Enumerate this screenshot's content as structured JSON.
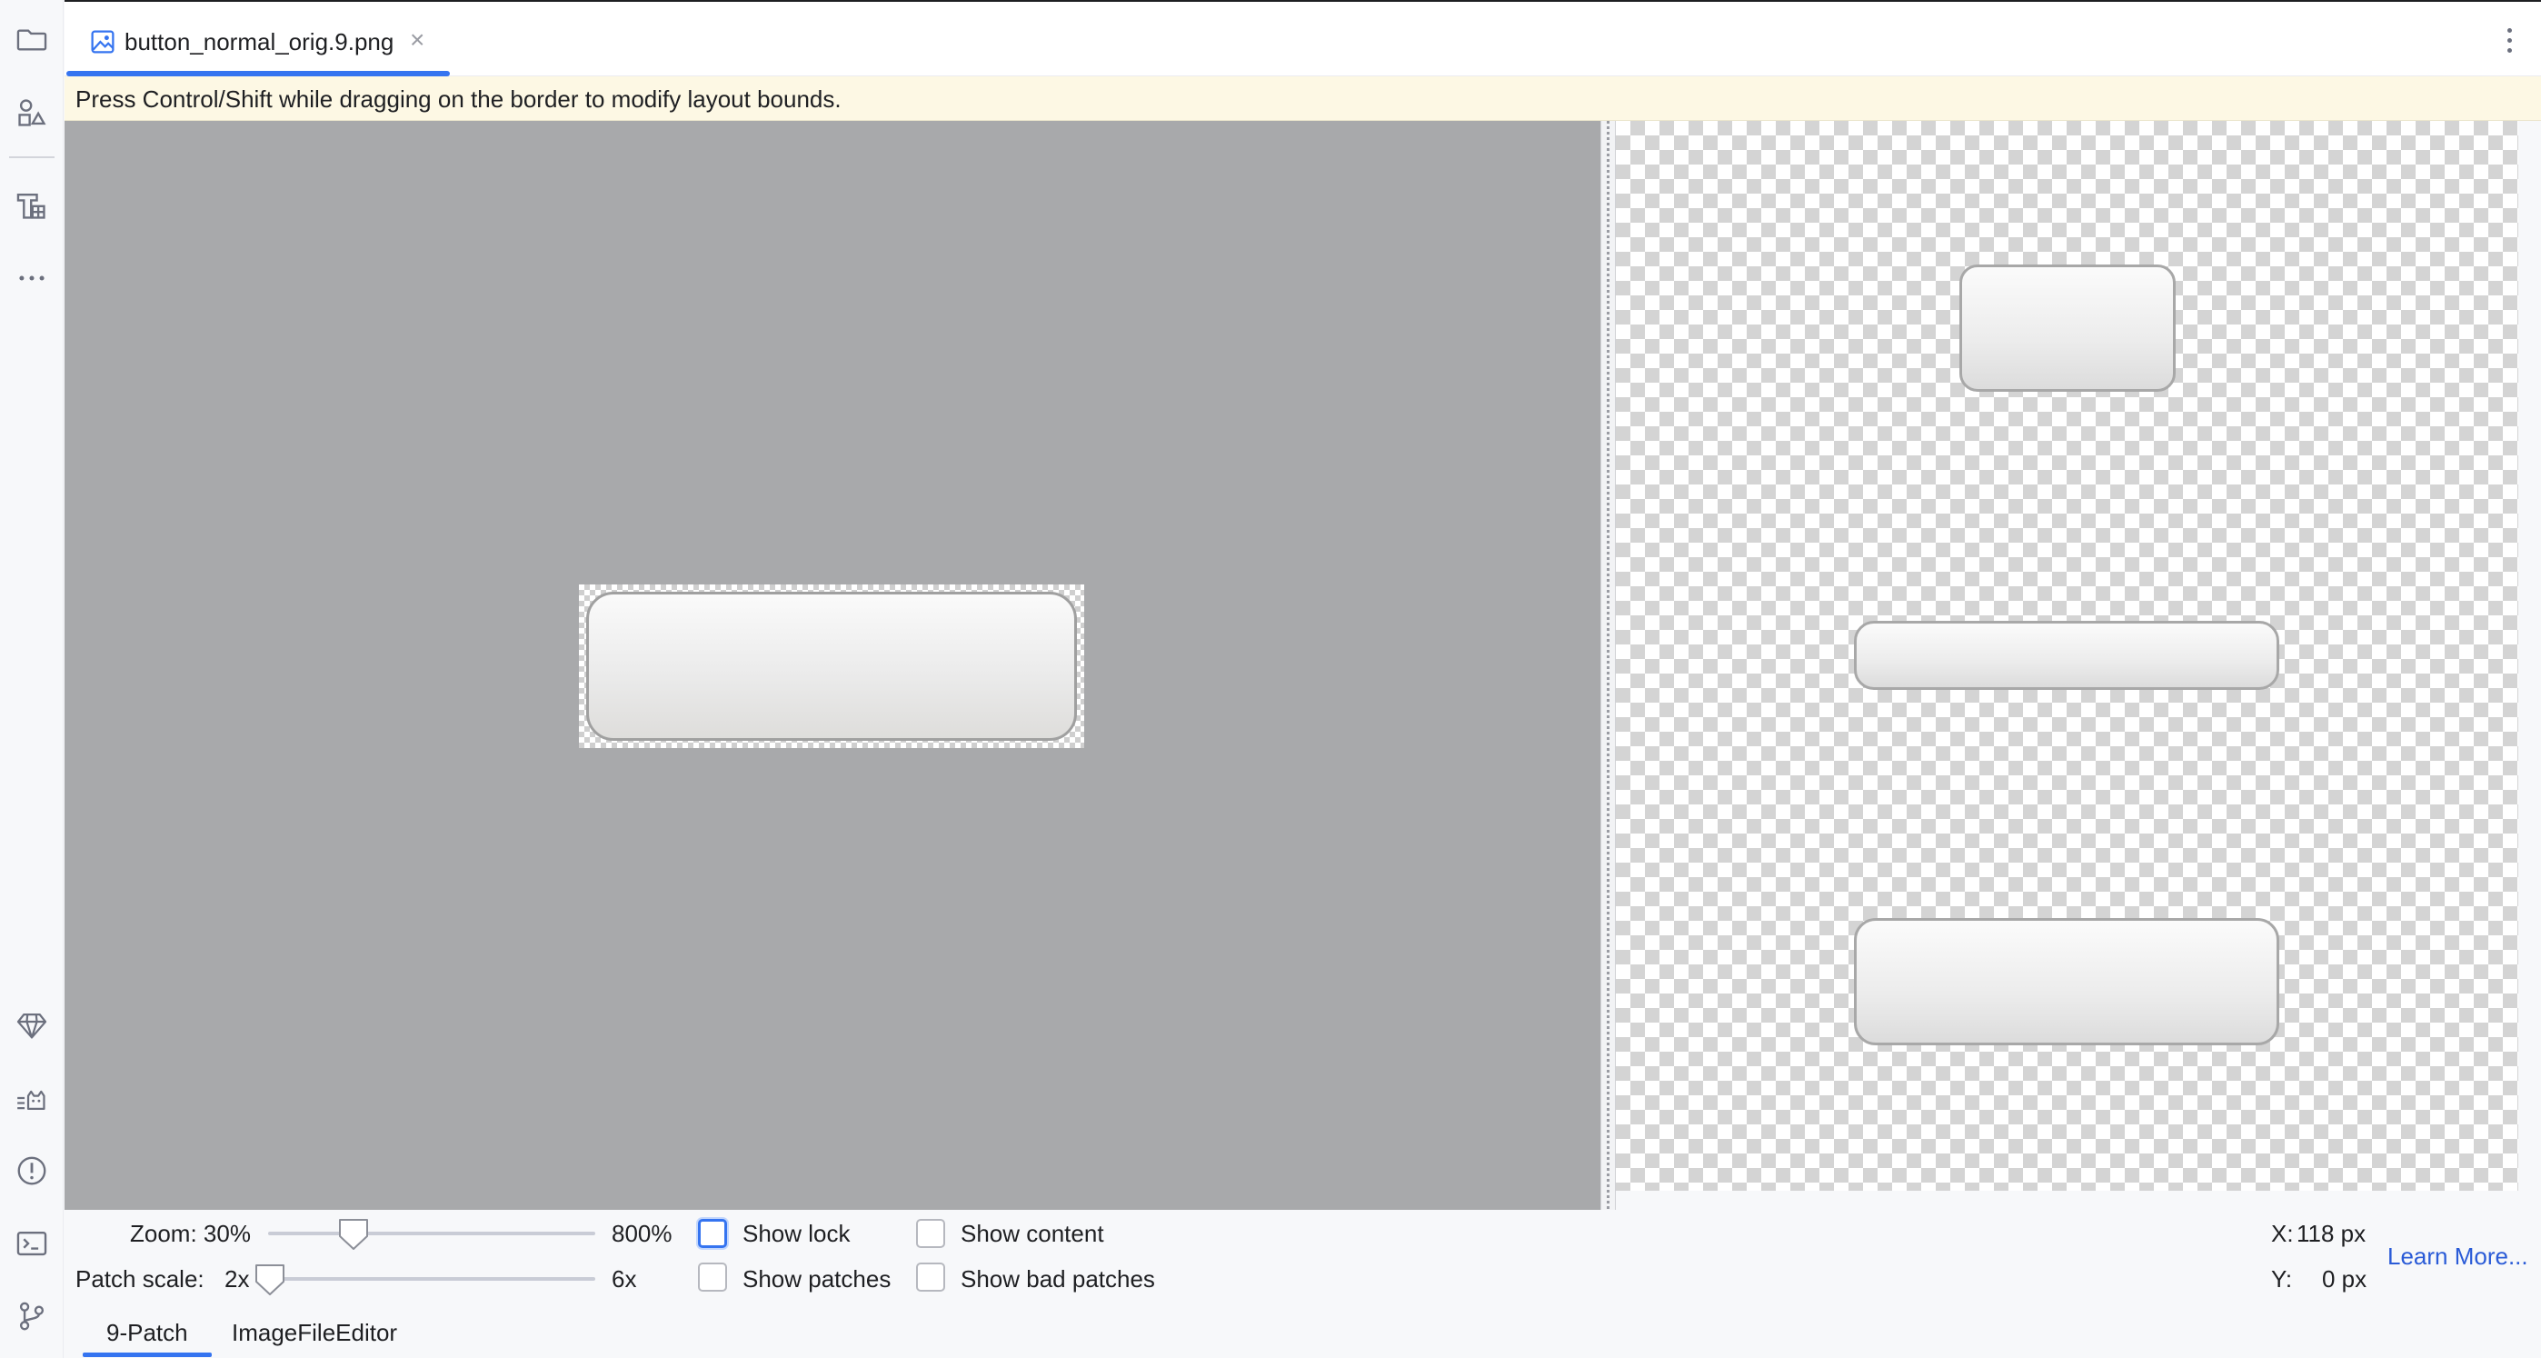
{
  "tool_window_bar": {
    "top_icons": [
      "folder-icon",
      "shapes-icon",
      "resource-manager-icon",
      "more-icon"
    ],
    "bottom_icons": [
      "gem-icon",
      "cat-icon",
      "problems-icon",
      "terminal-icon",
      "git-branch-icon"
    ]
  },
  "editor_tabs": [
    {
      "title": "button_normal_orig.9.png",
      "icon": "image-file-icon",
      "active": true,
      "close_glyph": "×"
    }
  ],
  "banner": {
    "text": "Press Control/Shift while dragging on the border to modify layout bounds."
  },
  "controls": {
    "zoom_label": "Zoom: 30%",
    "zoom_max_label": "800%",
    "zoom_value_percent": 30,
    "patch_scale_label": "Patch scale:",
    "patch_scale_min_label": "2x",
    "patch_scale_max_label": "6x",
    "patch_scale_value": 2,
    "checkboxes": {
      "show_lock": {
        "label": "Show lock",
        "checked": false
      },
      "show_content": {
        "label": "Show content",
        "checked": false
      },
      "show_patches": {
        "label": "Show patches",
        "checked": false
      },
      "show_bad_patches": {
        "label": "Show bad patches",
        "checked": false
      }
    },
    "x_label": "X:",
    "x_value": "118 px",
    "y_label": "Y:",
    "y_value": "0 px",
    "learn_more": "Learn More..."
  },
  "bottom_tabs": [
    {
      "label": "9-Patch",
      "active": true
    },
    {
      "label": "ImageFileEditor",
      "active": false
    }
  ],
  "colors": {
    "accent": "#3574f0",
    "canvas_background": "#a8a9ab",
    "banner_background": "#fdf8e4",
    "link": "#2a5bd7"
  }
}
